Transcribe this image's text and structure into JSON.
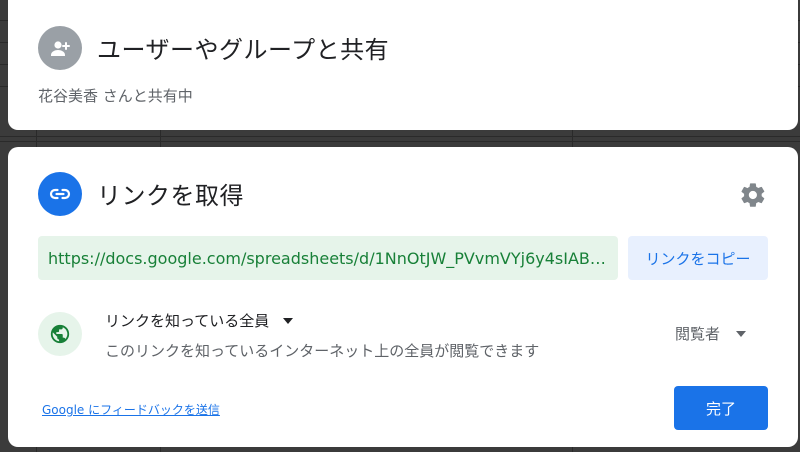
{
  "share_card": {
    "title": "ユーザーやグループと共有",
    "subtitle": "花谷美香 さんと共有中",
    "icon": "person-add-icon"
  },
  "link_card": {
    "title": "リンクを取得",
    "icon": "link-icon",
    "settings_icon": "gear-icon",
    "url": "https://docs.google.com/spreadsheets/d/1NnOtJW_PVvmVYj6y4sIAB…",
    "copy_label": "リンクをコピー",
    "access": {
      "icon": "globe-icon",
      "selected": "リンクを知っている全員",
      "description": "このリンクを知っているインターネット上の全員が閲覧できます"
    },
    "role": {
      "selected": "閲覧者"
    },
    "feedback_label": "Google にフィードバックを送信",
    "done_label": "完了"
  },
  "colors": {
    "accent": "#1a73e8",
    "url_bg": "#e6f4ea",
    "url_text": "#188038",
    "copy_bg": "#e8f0fe",
    "globe": "#188038",
    "avatar_gray": "#9aa0a6"
  }
}
